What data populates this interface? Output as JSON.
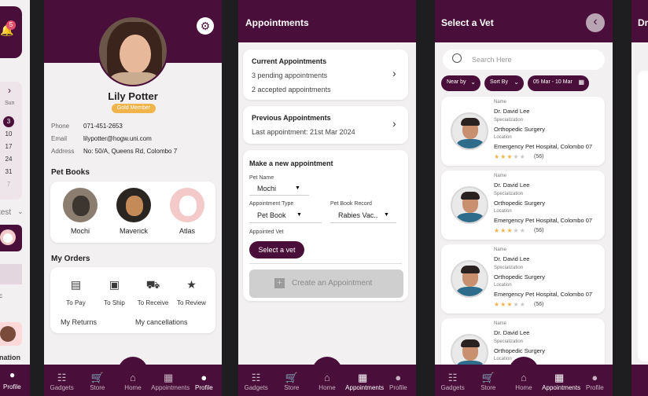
{
  "left_partial": {
    "notif_count": "5",
    "cal_day": "Sun",
    "cal_dates": [
      "3",
      "10",
      "17",
      "24",
      "31",
      "7"
    ],
    "selected_date": "3",
    "sort_label": "test",
    "ration_label": "nation",
    "nav_profile": "Profile",
    "partial_c": "c"
  },
  "profile": {
    "name": "Lily Potter",
    "badge": "Gold Member",
    "fields": [
      {
        "label": "Phone",
        "value": "071-451-2653"
      },
      {
        "label": "Email",
        "value": "lilypotter@hogw.uni.com"
      },
      {
        "label": "Address",
        "value": "No: 50/A, Queens Rd, Colombo 7"
      }
    ],
    "pet_books_title": "Pet Books",
    "pets": [
      "Mochi",
      "Maverick",
      "Atlas"
    ],
    "orders_title": "My Orders",
    "orders": [
      "To Pay",
      "To Ship",
      "To Receive",
      "To Review"
    ],
    "returns": "My Returns",
    "cancellations": "My cancellations"
  },
  "appointments": {
    "title": "Appointments",
    "current": {
      "title": "Current Appointments",
      "line1": "3 pending appointments",
      "line2": "2 accepted appointments"
    },
    "previous": {
      "title": "Previous Appointments",
      "line1": "Last appointment: 21st Mar 2024"
    },
    "form": {
      "title": "Make a new appointment",
      "pet_name_label": "Pet Name",
      "pet_name_value": "Mochi",
      "type_label": "Appointment Type",
      "type_value": "Pet Book",
      "record_label": "Pet Book Record",
      "record_value": "Rabies Vac..",
      "vet_label": "Appointed Vet",
      "select_vet": "Select a vet",
      "create": "Create an Appointment"
    }
  },
  "vets": {
    "title": "Select a Vet",
    "search_placeholder": "Search Here",
    "filters": [
      "Near by",
      "Sort By",
      "05 Mar - 10 Mar"
    ],
    "name_label": "Name",
    "spec_label": "Specialization",
    "loc_label": "Location",
    "cards": [
      {
        "name": "Dr. David Lee",
        "spec": "Orthopedic Surgery",
        "loc": "Emergency Pet Hospital, Colombo 07",
        "rating": 3,
        "reviews": "(56)"
      },
      {
        "name": "Dr. David Lee",
        "spec": "Orthopedic Surgery",
        "loc": "Emergency Pet Hospital, Colombo 07",
        "rating": 3,
        "reviews": "(56)"
      },
      {
        "name": "Dr. David Lee",
        "spec": "Orthopedic Surgery",
        "loc": "Emergency Pet Hospital, Colombo 07",
        "rating": 3,
        "reviews": "(56)"
      },
      {
        "name": "Dr. David Lee",
        "spec": "Orthopedic Surgery",
        "loc": "Emergency Pet Hospital, Colombo 07",
        "rating": 3,
        "reviews": "(56)"
      }
    ]
  },
  "right_partial": {
    "title": "Dr"
  },
  "nav": [
    "Gadgets",
    "Store",
    "Home",
    "Appointments",
    "Profile"
  ],
  "colors": {
    "plum": "#4a0e3a",
    "gold": "#f0b44a",
    "star": "#f0b44a"
  }
}
